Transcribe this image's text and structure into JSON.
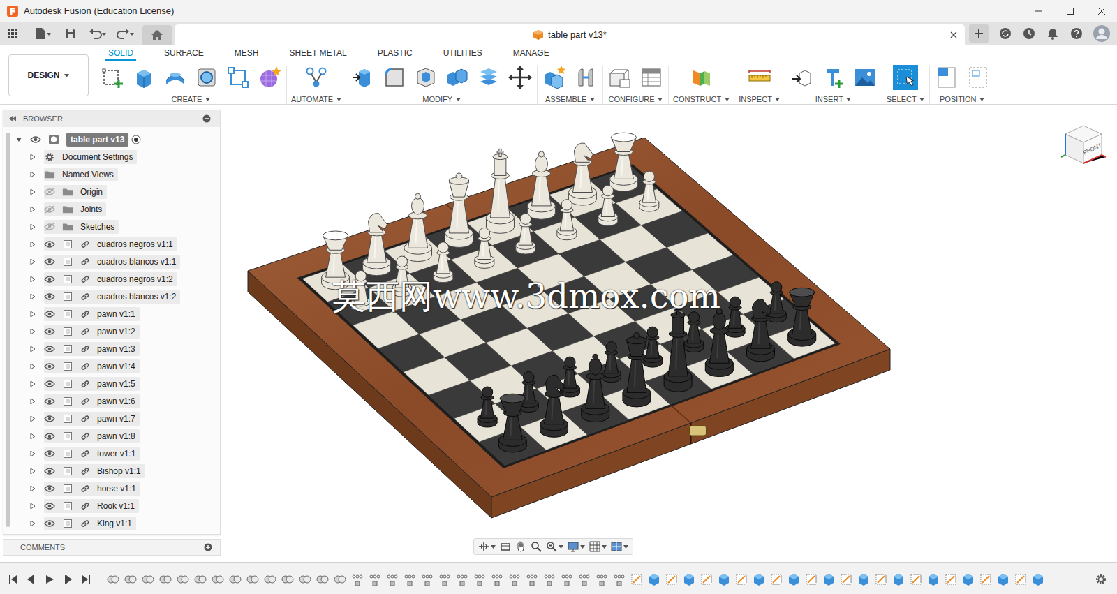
{
  "window": {
    "title": "Autodesk Fusion (Education License)"
  },
  "document_tab": {
    "title": "table part v13*"
  },
  "workspace": {
    "label": "DESIGN"
  },
  "ribbon_tabs": [
    {
      "label": "SOLID",
      "selected": true
    },
    {
      "label": "SURFACE",
      "selected": false
    },
    {
      "label": "MESH",
      "selected": false
    },
    {
      "label": "SHEET METAL",
      "selected": false
    },
    {
      "label": "PLASTIC",
      "selected": false
    },
    {
      "label": "UTILITIES",
      "selected": false
    },
    {
      "label": "MANAGE",
      "selected": false
    }
  ],
  "tool_groups": [
    {
      "label": "CREATE",
      "selected": false
    },
    {
      "label": "AUTOMATE",
      "selected": false
    },
    {
      "label": "MODIFY",
      "selected": false
    },
    {
      "label": "ASSEMBLE",
      "selected": false
    },
    {
      "label": "CONFIGURE",
      "selected": false
    },
    {
      "label": "CONSTRUCT",
      "selected": false
    },
    {
      "label": "INSPECT",
      "selected": false
    },
    {
      "label": "INSERT",
      "selected": false
    },
    {
      "label": "SELECT",
      "selected": true
    },
    {
      "label": "POSITION",
      "selected": false
    }
  ],
  "browser": {
    "title": "BROWSER",
    "root": {
      "label": "table part v13",
      "expanded": true,
      "visible": true,
      "active": true
    },
    "items": [
      {
        "label": "Document Settings",
        "kind": "settings",
        "expanded": false
      },
      {
        "label": "Named Views",
        "kind": "views",
        "expanded": false
      },
      {
        "label": "Origin",
        "kind": "folder",
        "expanded": false,
        "visible": false
      },
      {
        "label": "Joints",
        "kind": "folder",
        "expanded": false,
        "visible": false
      },
      {
        "label": "Sketches",
        "kind": "folder",
        "expanded": false,
        "visible": false
      },
      {
        "label": "cuadros negros v1:1",
        "kind": "component",
        "expanded": false,
        "visible": true
      },
      {
        "label": "cuadros blancos v1:1",
        "kind": "component",
        "expanded": false,
        "visible": true
      },
      {
        "label": "cuadros negros v1:2",
        "kind": "component",
        "expanded": false,
        "visible": true
      },
      {
        "label": "cuadros blancos v1:2",
        "kind": "component",
        "expanded": false,
        "visible": true
      },
      {
        "label": "pawn v1:1",
        "kind": "component",
        "expanded": false,
        "visible": true
      },
      {
        "label": "pawn v1:2",
        "kind": "component",
        "expanded": false,
        "visible": true
      },
      {
        "label": "pawn v1:3",
        "kind": "component",
        "expanded": false,
        "visible": true
      },
      {
        "label": "pawn v1:4",
        "kind": "component",
        "expanded": false,
        "visible": true
      },
      {
        "label": "pawn v1:5",
        "kind": "component",
        "expanded": false,
        "visible": true
      },
      {
        "label": "pawn v1:6",
        "kind": "component",
        "expanded": false,
        "visible": true
      },
      {
        "label": "pawn v1:7",
        "kind": "component",
        "expanded": false,
        "visible": true
      },
      {
        "label": "pawn v1:8",
        "kind": "component",
        "expanded": false,
        "visible": true
      },
      {
        "label": "tower v1:1",
        "kind": "component",
        "expanded": false,
        "visible": true
      },
      {
        "label": "Bishop v1:1",
        "kind": "component",
        "expanded": false,
        "visible": true
      },
      {
        "label": "horse v1:1",
        "kind": "component",
        "expanded": false,
        "visible": true
      },
      {
        "label": "Rook v1:1",
        "kind": "component",
        "expanded": false,
        "visible": true
      },
      {
        "label": "King v1:1",
        "kind": "component",
        "expanded": false,
        "visible": true
      }
    ]
  },
  "comments": {
    "title": "COMMENTS"
  },
  "viewport": {
    "watermark": "莫西网www.3dmox.com",
    "viewcube": "FRONT"
  },
  "timeline": {
    "features": [
      "joint",
      "joint",
      "joint",
      "joint",
      "joint",
      "joint",
      "joint",
      "joint",
      "joint",
      "joint",
      "joint",
      "joint",
      "joint",
      "joint",
      "rigid-group",
      "rigid-group",
      "rigid-group",
      "rigid-group",
      "rigid-group",
      "rigid-group",
      "rigid-group",
      "rigid-group",
      "rigid-group",
      "rigid-group",
      "rigid-group",
      "rigid-group",
      "rigid-group",
      "rigid-group",
      "rigid-group",
      "rigid-group",
      "sketch",
      "extrude",
      "sketch",
      "extrude",
      "sketch",
      "extrude",
      "sketch",
      "extrude",
      "sketch",
      "extrude",
      "sketch",
      "extrude",
      "sketch",
      "extrude",
      "sketch",
      "extrude",
      "sketch",
      "extrude",
      "sketch",
      "extrude",
      "sketch",
      "extrude",
      "sketch",
      "extrude"
    ]
  }
}
